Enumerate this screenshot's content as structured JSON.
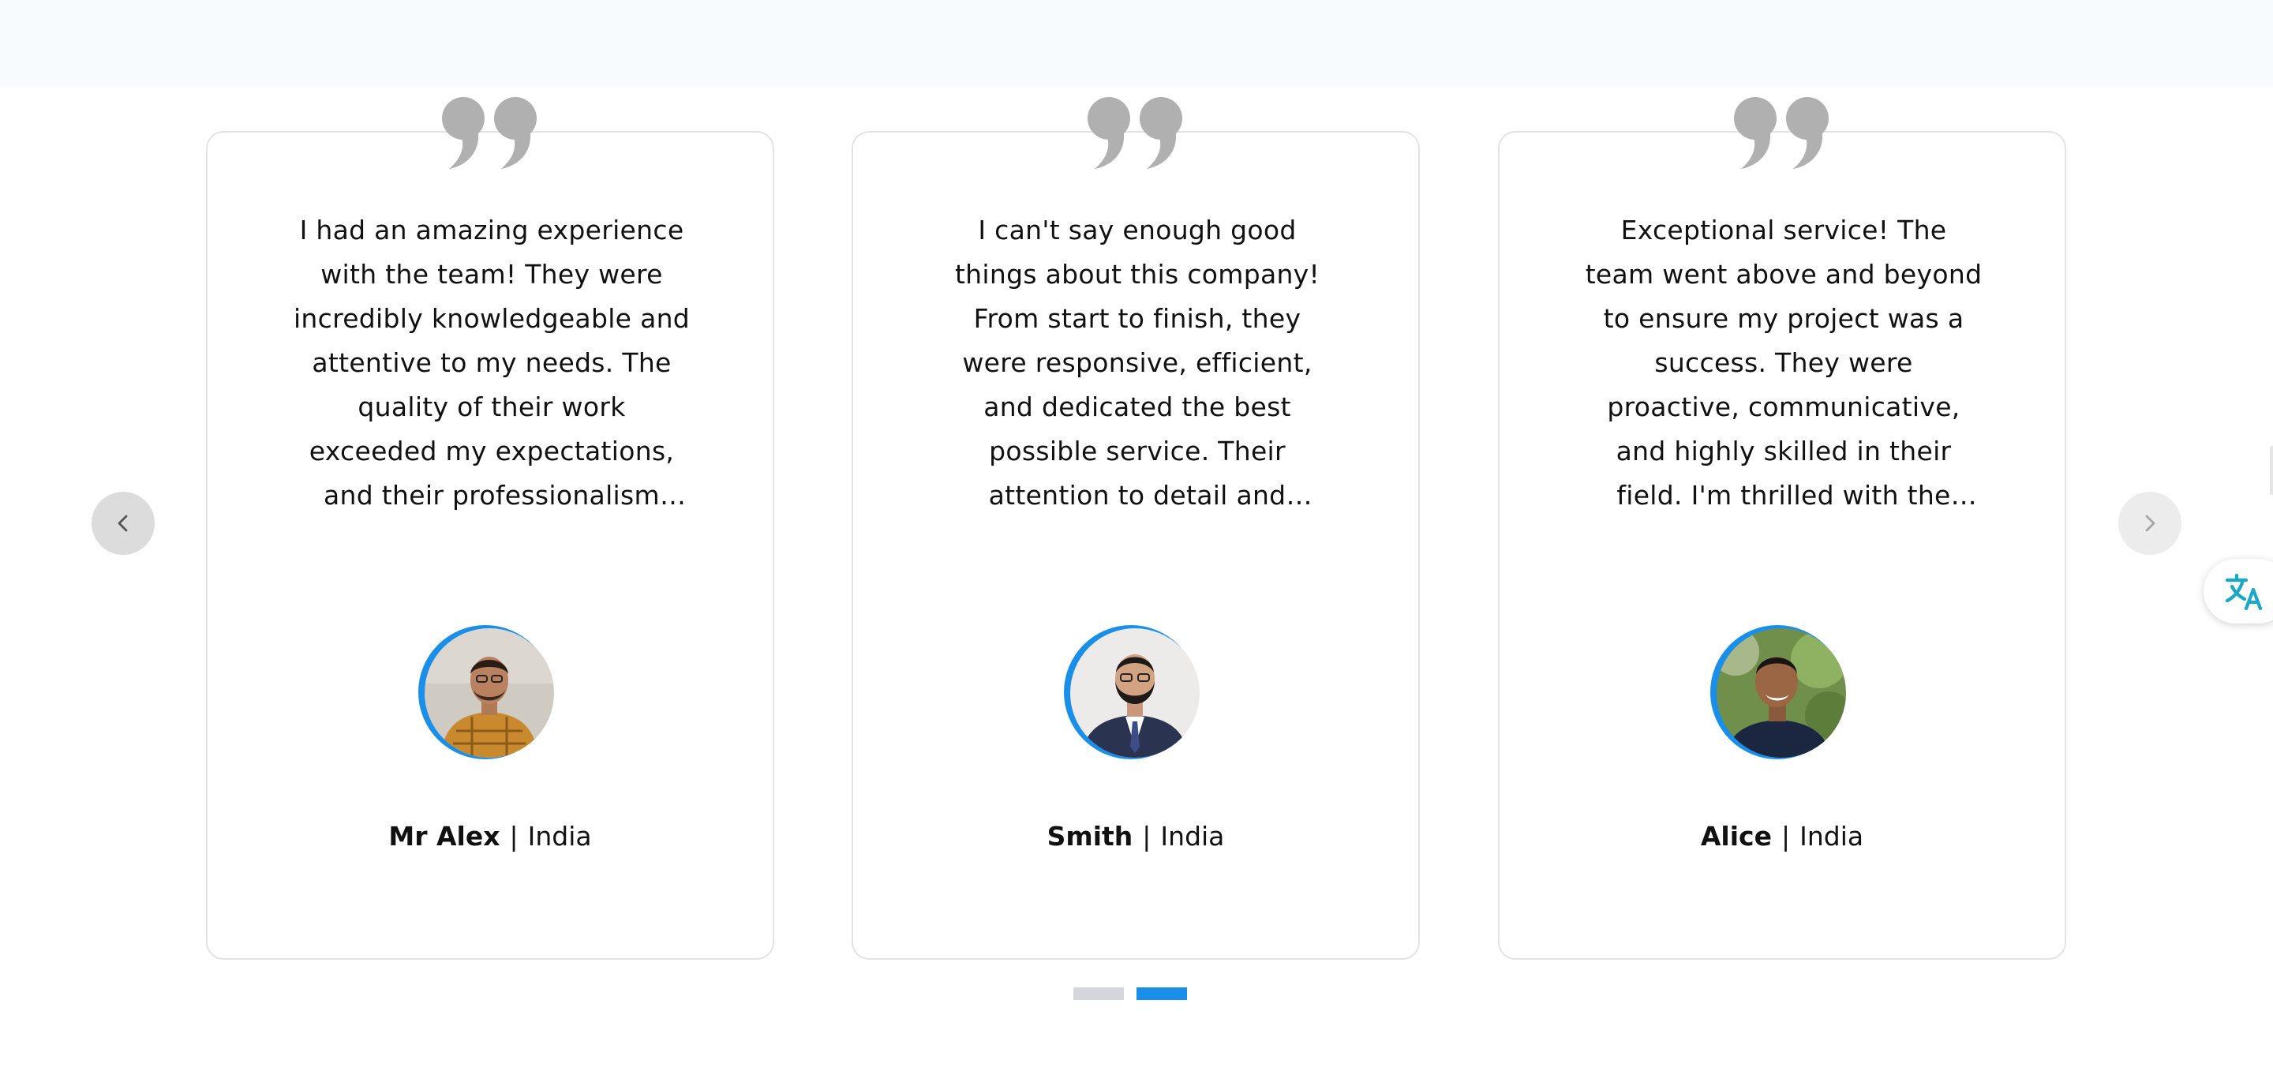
{
  "testimonials": [
    {
      "quote": "I had an amazing experience with the team! They were incredibly knowledgeable and attentive to my needs. The quality of their work exceeded my expectations, and their professionalism was…",
      "name": "Mr Alex",
      "separator": "|",
      "location": "India"
    },
    {
      "quote": "I can't say enough good things about this company! From start to finish, they were responsive, efficient, and dedicated the best possible service. Their attention to detail and commitment to customer satisfaction were trul…",
      "name": "Smith",
      "separator": "|",
      "location": "India"
    },
    {
      "quote": "Exceptional service! The team went above and beyond to ensure my project was a success. They were proactive, communicative, and highly skilled in their field. I'm thrilled with the results and wouldn't…",
      "name": "Alice",
      "separator": "|",
      "location": "India"
    }
  ],
  "carousel": {
    "prev_icon": "chevron-left-icon",
    "next_icon": "chevron-right-icon",
    "page_count": 2,
    "active_page": 2
  },
  "colors": {
    "accent": "#1a8fea",
    "quote_mark": "#b0b0b0",
    "card_border": "#e3e3e3",
    "band": "#f8fbfe",
    "translate_icon": "#19a9c7"
  },
  "icons": {
    "quote": "quote-icon",
    "translate": "translate-icon"
  }
}
